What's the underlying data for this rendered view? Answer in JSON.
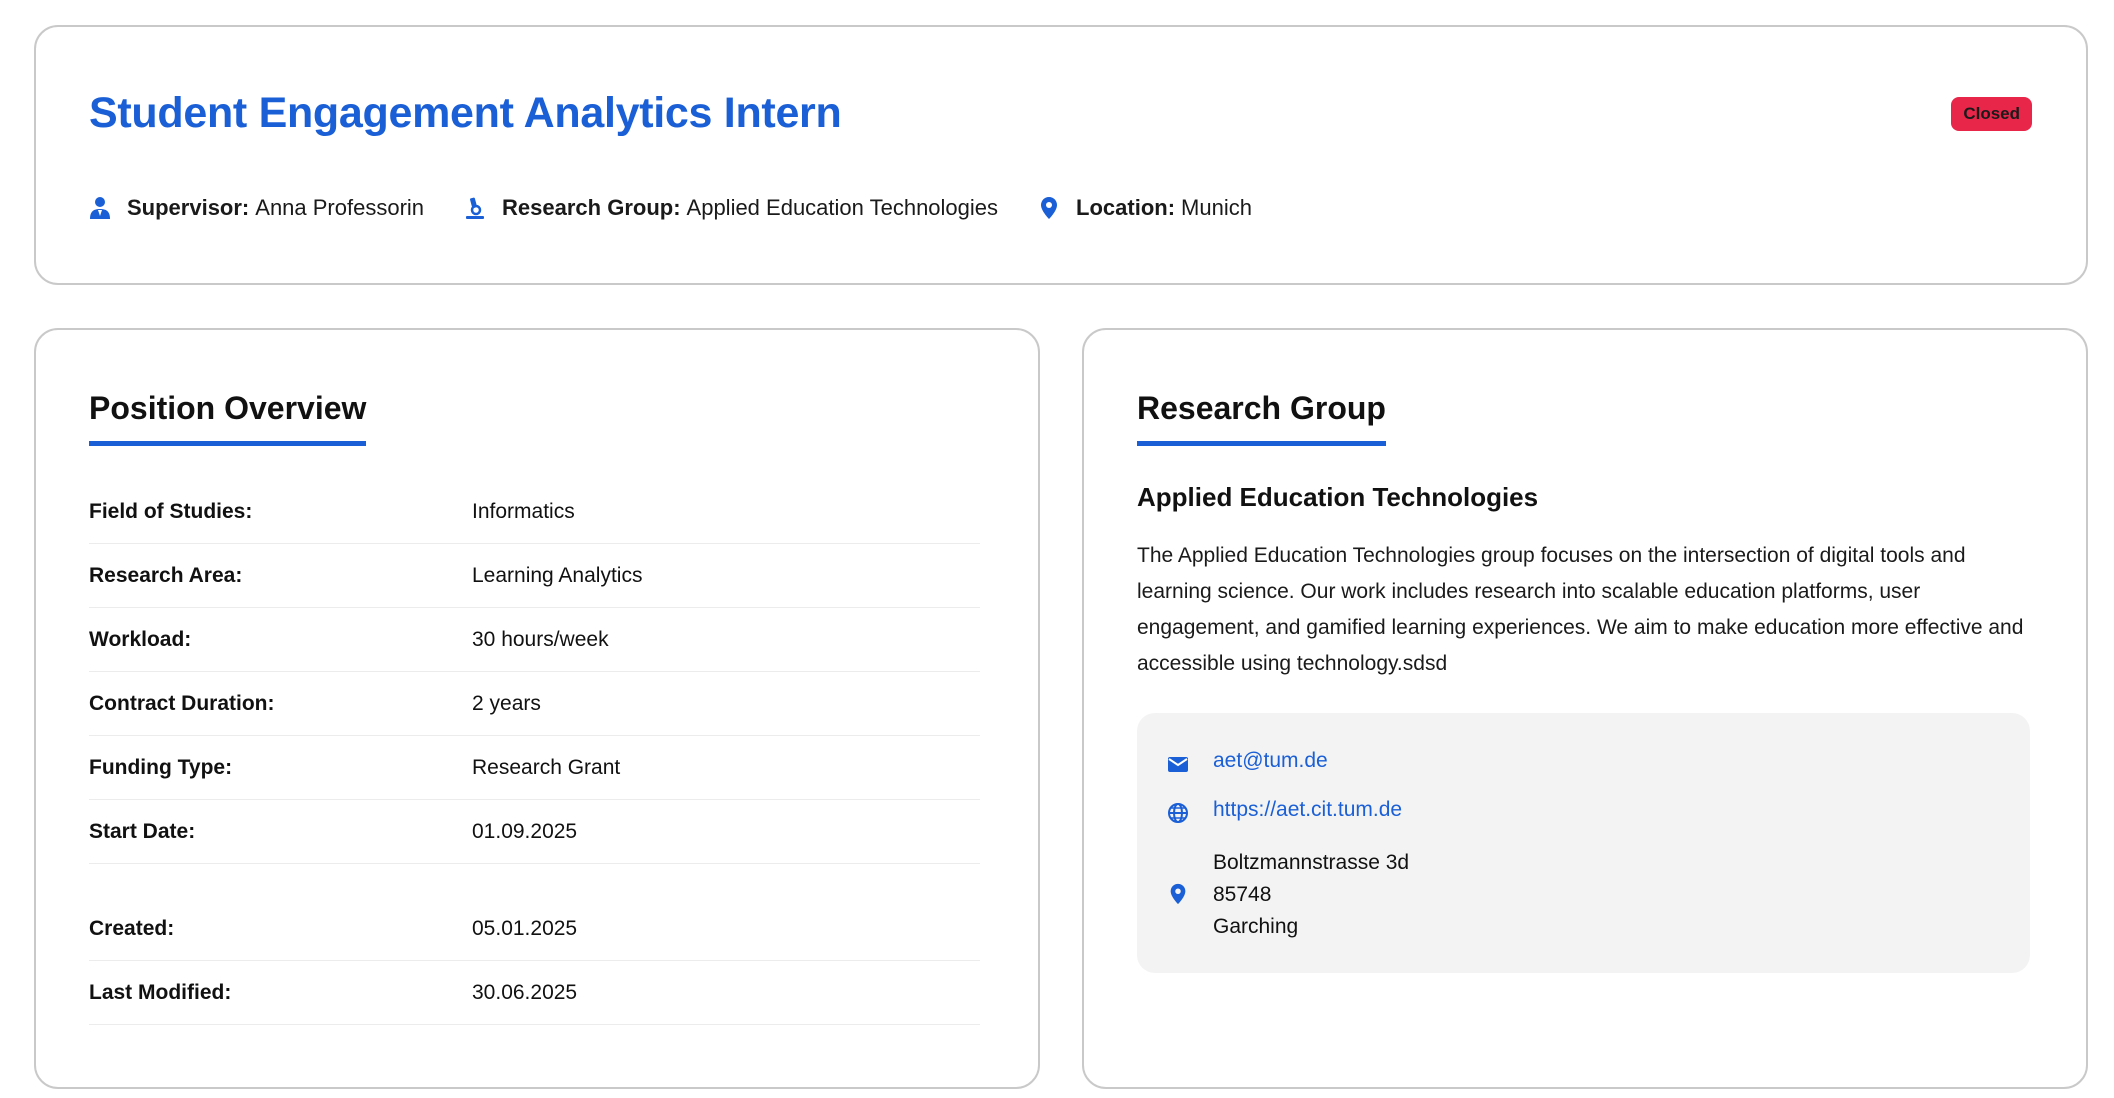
{
  "job": {
    "title": "Student Engagement Analytics Intern",
    "status": "Closed",
    "supervisor_label": "Supervisor:",
    "supervisor": "Anna Professorin",
    "group_label": "Research Group:",
    "group": "Applied Education Technologies",
    "location_label": "Location:",
    "location": "Munich"
  },
  "overview": {
    "title": "Position Overview",
    "rows": [
      {
        "label": "Field of Studies:",
        "value": "Informatics"
      },
      {
        "label": "Research Area:",
        "value": "Learning Analytics"
      },
      {
        "label": "Workload:",
        "value": "30 hours/week"
      },
      {
        "label": "Contract Duration:",
        "value": "2 years"
      },
      {
        "label": "Funding Type:",
        "value": "Research Grant"
      },
      {
        "label": "Start Date:",
        "value": "01.09.2025"
      }
    ],
    "dates": [
      {
        "label": "Created:",
        "value": "05.01.2025"
      },
      {
        "label": "Last Modified:",
        "value": "30.06.2025"
      }
    ]
  },
  "research_group": {
    "title": "Research Group",
    "name": "Applied Education Technologies",
    "description": "The Applied Education Technologies group focuses on the intersection of digital tools and learning science. Our work includes research into scalable education platforms, user engagement, and gamified learning experiences. We aim to make education more effective and accessible using technology.sdsd",
    "email": "aet@tum.de",
    "website": "https://aet.cit.tum.de",
    "address": {
      "street": "Boltzmannstrasse 3d",
      "zip": "85748",
      "city": "Garching"
    }
  },
  "colors": {
    "accent": "#1a5fd6",
    "status_closed": "#e8264a",
    "contact_bg": "#f3f3f3"
  },
  "icons": [
    "supervisor-icon",
    "research-group-icon",
    "location-pin-icon",
    "email-icon",
    "globe-icon",
    "address-pin-icon"
  ]
}
